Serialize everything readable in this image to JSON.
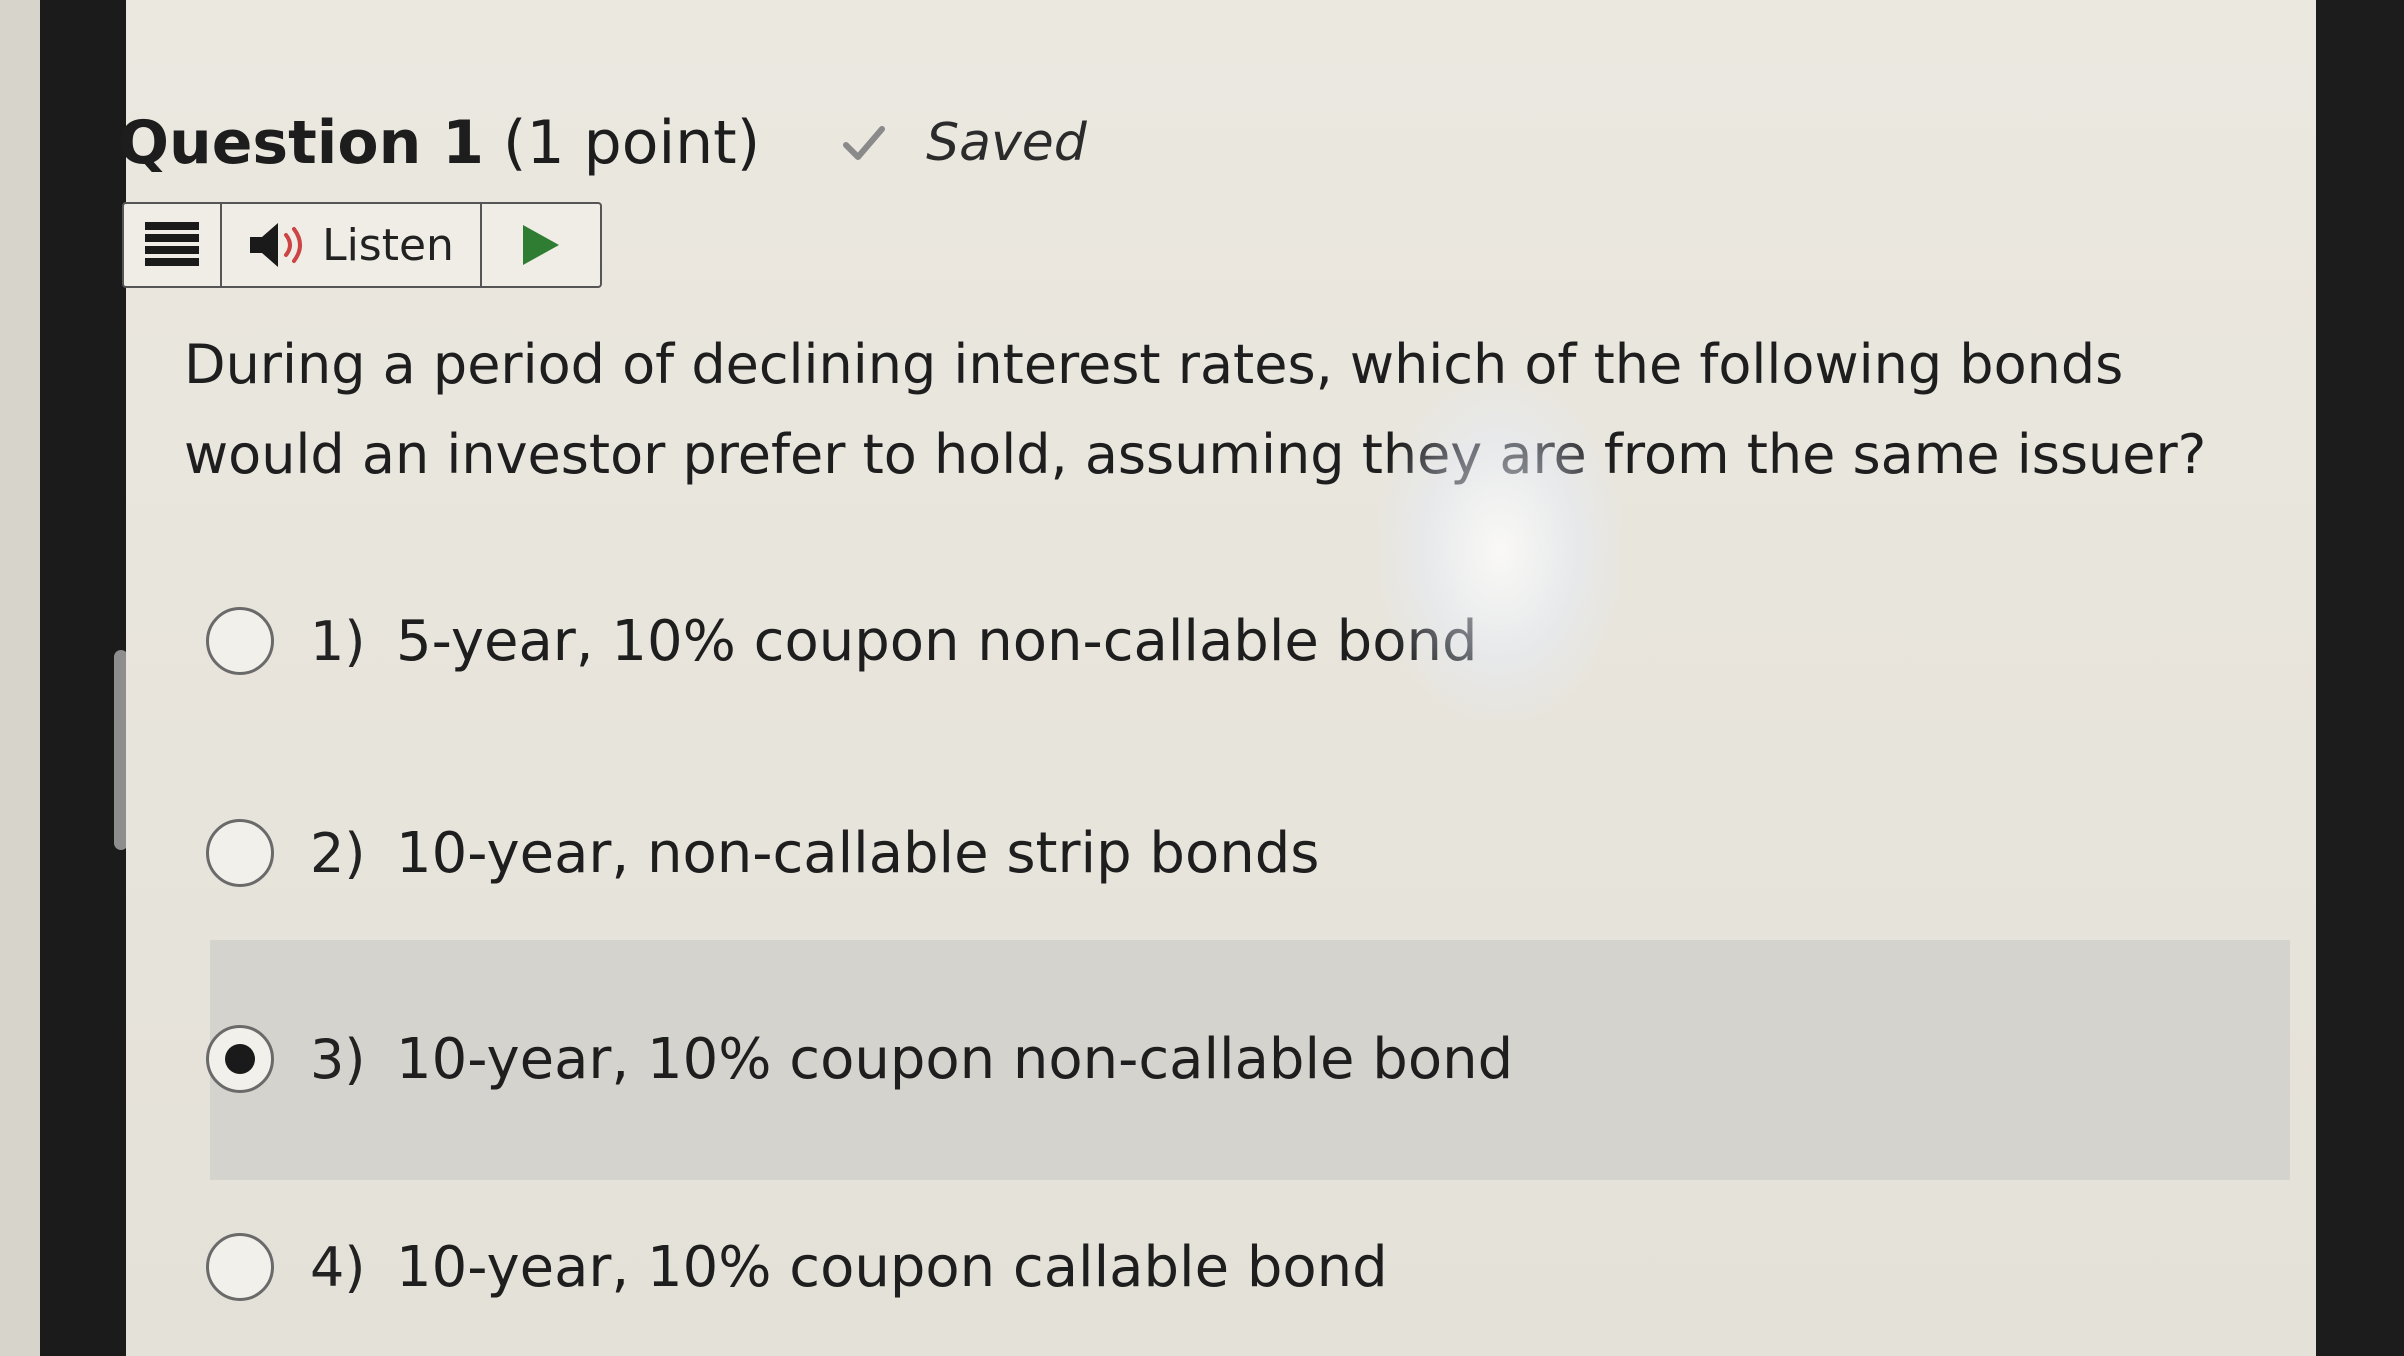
{
  "question": {
    "title_bold": "Question 1",
    "title_points": "(1 point)",
    "saved_label": "Saved",
    "text": "During a period of declining interest rates, which of the following bonds would an investor prefer to hold, assuming they are from the same issuer?"
  },
  "listen_toolbar": {
    "listen_label": "Listen",
    "icons": [
      "menu-icon",
      "speaker-icon",
      "play-icon"
    ]
  },
  "options": [
    {
      "number": "1)",
      "label": "5-year, 10% coupon non-callable bond",
      "selected": false
    },
    {
      "number": "2)",
      "label": "10-year, non-callable strip bonds",
      "selected": false
    },
    {
      "number": "3)",
      "label": "10-year, 10% coupon non-callable bond",
      "selected": true
    },
    {
      "number": "4)",
      "label": "10-year, 10% coupon callable bond",
      "selected": false
    }
  ],
  "colors": {
    "selected_row": "#d4d3cd",
    "play_green": "#2e7d32",
    "check_gray": "#8a8a8a"
  }
}
